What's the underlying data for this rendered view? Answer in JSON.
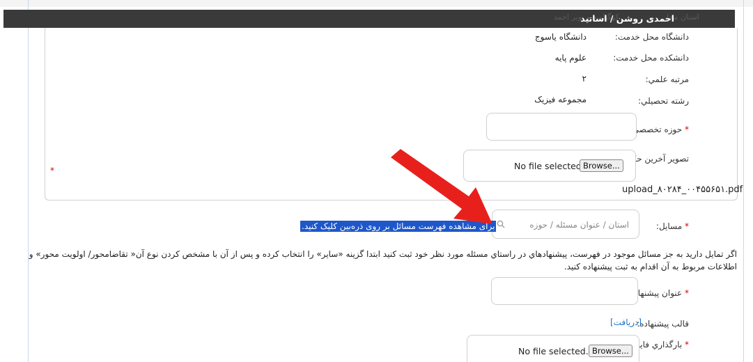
{
  "header": {
    "name_title": "احمدی روشن / اساتید",
    "province_faded": "کهگیلویه و بویر احمد",
    "ghost_label": "استان محل"
  },
  "profile": {
    "university_label": "دانشگاه محل خدمت:",
    "university_value": "دانشگاه یاسوج",
    "faculty_label": "دانشکده محل خدمت:",
    "faculty_value": "علوم پایه",
    "rank_label": "مرتبه علمي:",
    "rank_value": "۲",
    "field_label": "رشته تحصيلي:",
    "field_value": "مجموعه فيزيک",
    "specialty_label": "حوزه تخصصي:",
    "specialty_required": "*",
    "specialty_value": "",
    "last_order_label": "تصوير آخرين حكم كارگزيني:",
    "last_order_required": "*",
    "last_order_file_status": "No file selected.",
    "last_order_browse": "Browse...",
    "uploaded_file": "upload_۸۰۲۸۴_۰۰۴۵۵۶۵۱.pdf"
  },
  "issues": {
    "label": "مسایل:",
    "required": "*",
    "search_placeholder": "استان / عنوان مسئله / حوزه",
    "hint_highlighted": "برای مشاهده فهرست مسائل بر روی ذره‌بین کلیک کنید."
  },
  "instructions": {
    "line1": "اگر تمایل دارید به جز مسائل موجود در فهرست، پیشنهادهاي در راستاي مسئله مورد نظر خود ثبت کنید ابتدا گزینه «سایر» را انتخاب کرده و پس از آن با مشخص کردن نوع آن« تقاضامحور/ اولویت محور» و",
    "line2": "اطلاعات مربوط به آن اقدام به ثبت پیشنهاده کنید."
  },
  "proposal": {
    "title_label": "عنوان پیشنهاده:",
    "title_required": "*",
    "title_value": "",
    "template_label": "قالب پيشنهاده:",
    "template_link": "[دریافت]",
    "upload_label": "بارگذاري فايل پيشنهاده:",
    "upload_required": "*",
    "upload_file_status": "No file selected.",
    "upload_browse": "Browse..."
  },
  "colors": {
    "dark_bar": "#3a3a3a",
    "highlight": "#1e57c9",
    "required": "#d40000",
    "link": "#1a73c8",
    "arrow": "#e8201c"
  },
  "icons": {
    "search": "magnifier-icon",
    "annotation": "red-arrow-icon"
  }
}
